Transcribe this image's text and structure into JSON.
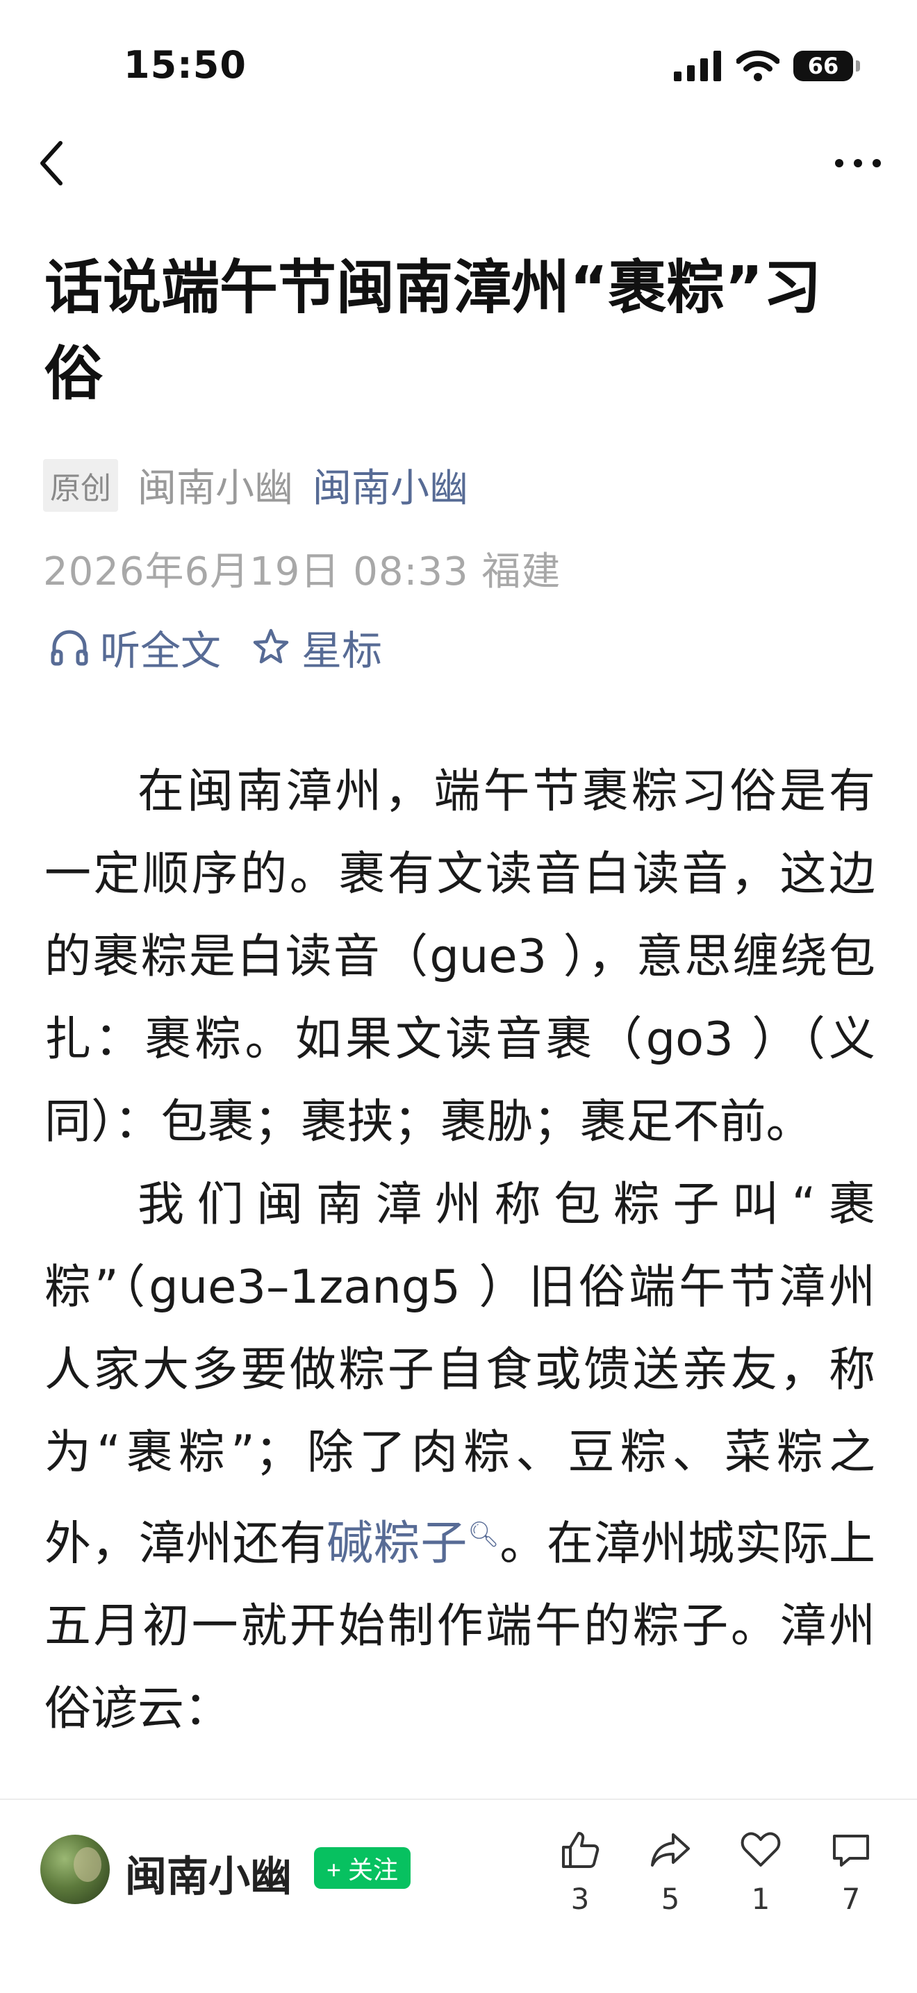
{
  "status_bar": {
    "time": "15:50",
    "battery": "66"
  },
  "article": {
    "title": "话说端午节闽南漳州“裹粽”习俗",
    "original_tag": "原创",
    "author_name": "闽南小幽",
    "account_name": "闽南小幽",
    "date_location": "2026年6月19日 08:33 福建",
    "listen_label": "听全文",
    "star_label": "星标",
    "paragraphs": [
      {
        "text": "在闽南漳州，端午节裹粽习俗是有一定顺序的。裹有文读音白读音，这边的裹粽是白读音（gue3 ），意思缠绕包扎：裹粽。如果文读音裹（go3 ）（义同）：包裹；裹挟；裹胁；裹足不前。"
      },
      {
        "pre": "我们闽南漳州称包粽子叫“裹粽”（gue3–1zang5 ）旧俗端午节漳州人家大多要做粽子自食或馈送亲友，称为“裹粽”；除了肉粽、豆粽、菜粽之外，漳州还有",
        "keyword": "碱粽子",
        "post": "。在漳州城实际上五月初一就开始制作端午的粽子。漳州俗谚云："
      }
    ]
  },
  "bottom_bar": {
    "author": "闽南小幽",
    "follow_label": "+ 关注",
    "likes": "3",
    "shares": "5",
    "favorites": "1",
    "comments": "7"
  }
}
